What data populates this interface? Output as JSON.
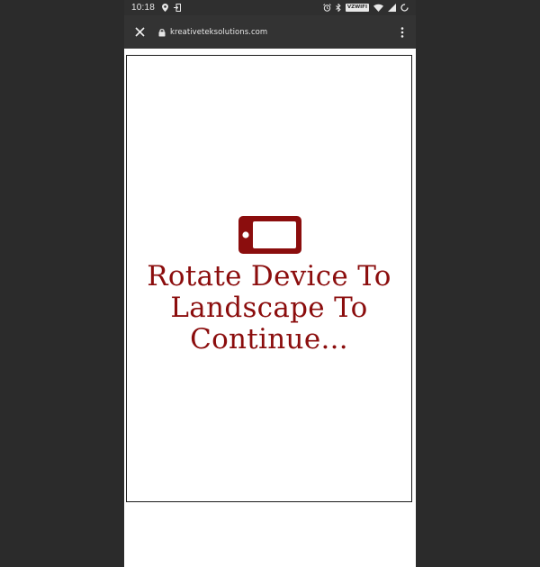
{
  "status_bar": {
    "time": "10:18",
    "left_icons": [
      "location-pin-icon",
      "sign-in-icon"
    ],
    "right_icons": [
      "alarm-icon",
      "bluetooth-icon",
      "vzwifi-badge",
      "wifi-icon",
      "signal-icon",
      "battery-charging-icon"
    ],
    "carrier_badge": "VZWIFI"
  },
  "browser_toolbar": {
    "close_icon": "close-icon",
    "lock_icon": "lock-icon",
    "url": "kreativeteksolutions.com",
    "menu_icon": "more-vert-icon"
  },
  "page": {
    "message": "Rotate Device To Landscape To Continue...",
    "icon": "mobile-landscape-icon",
    "accent_color": "#8b0d0d"
  }
}
